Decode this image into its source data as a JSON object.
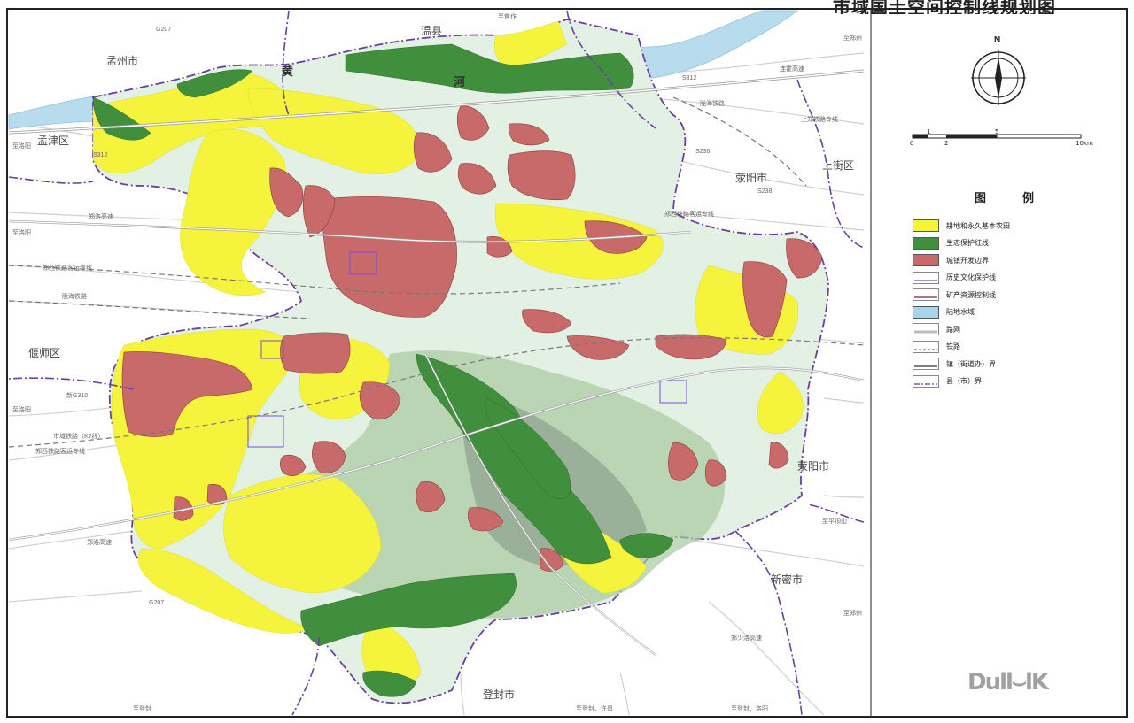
{
  "title": "市域国土空间控制线规划图",
  "north": "N",
  "scale": {
    "ticks": [
      "0",
      "1",
      "2",
      "5",
      "10km"
    ]
  },
  "legend": {
    "title": "图　例",
    "items": [
      {
        "label": "耕地和永久基本农田",
        "color": "#f5f33c",
        "kind": "fill"
      },
      {
        "label": "生态保护红线",
        "color": "#3f8f3d",
        "kind": "fill"
      },
      {
        "label": "城镇开发边界",
        "color": "#c96a6a",
        "kind": "fill"
      },
      {
        "label": "历史文化保护线",
        "color": "#7a4fd6",
        "kind": "line"
      },
      {
        "label": "矿产资源控制线",
        "color": "#7a2b2b",
        "kind": "line"
      },
      {
        "label": "陆地水域",
        "color": "#a8d4ea",
        "kind": "fill"
      },
      {
        "label": "路网",
        "color": "#bbbbbb",
        "kind": "road"
      },
      {
        "label": "铁路",
        "color": "#777777",
        "kind": "dashed"
      },
      {
        "label": "镇（街道办）界",
        "color": "#333333",
        "kind": "line"
      },
      {
        "label": "县（市）界",
        "color": "#6a3fa0",
        "kind": "dashdot"
      }
    ]
  },
  "places": {
    "mengzhou": "孟州市",
    "wenxian": "温县",
    "mengjin": "孟津区",
    "yanshi": "偃师区",
    "xingyang_top": "荥阳市",
    "shangjie": "上街区",
    "xingyang_right": "荥阳市",
    "xinmi": "新密市",
    "dengfeng": "登封市",
    "yellow_river_1": "黄",
    "yellow_river_2": "河"
  },
  "roads": {
    "s312_top": "S312",
    "s312_left": "S312",
    "liangao": "连霍高速",
    "longhai": "陇海铁路",
    "zhengxi": "郑西铁路客运专线",
    "zhengluo": "郑洛高速",
    "zhengluo_gs": "郑洛高速",
    "g207_top": "G207",
    "g207_bottom": "G207",
    "g310": "新G310",
    "k2": "市域铁路（K2线）",
    "shangdu": "上郑铁路专线",
    "s236": "S236",
    "s238": "S238",
    "zhengshao": "郑少洛高速",
    "to_zhengzhou_1": "至郑州",
    "to_zhengzhou_2": "至郑州",
    "to_luoyang_1": "至洛阳",
    "to_luoyang_2": "至洛阳",
    "to_luoyang_3": "至洛阳",
    "to_dengfeng": "至登封",
    "to_dengfeng_luoyang": "至登封、洛阳",
    "to_dengfeng_xuchang": "至登封、许昌",
    "to_jiaozuo": "至焦作",
    "to_pingdingshan": "至平顶山"
  },
  "watermark": "Dull⌣lK"
}
